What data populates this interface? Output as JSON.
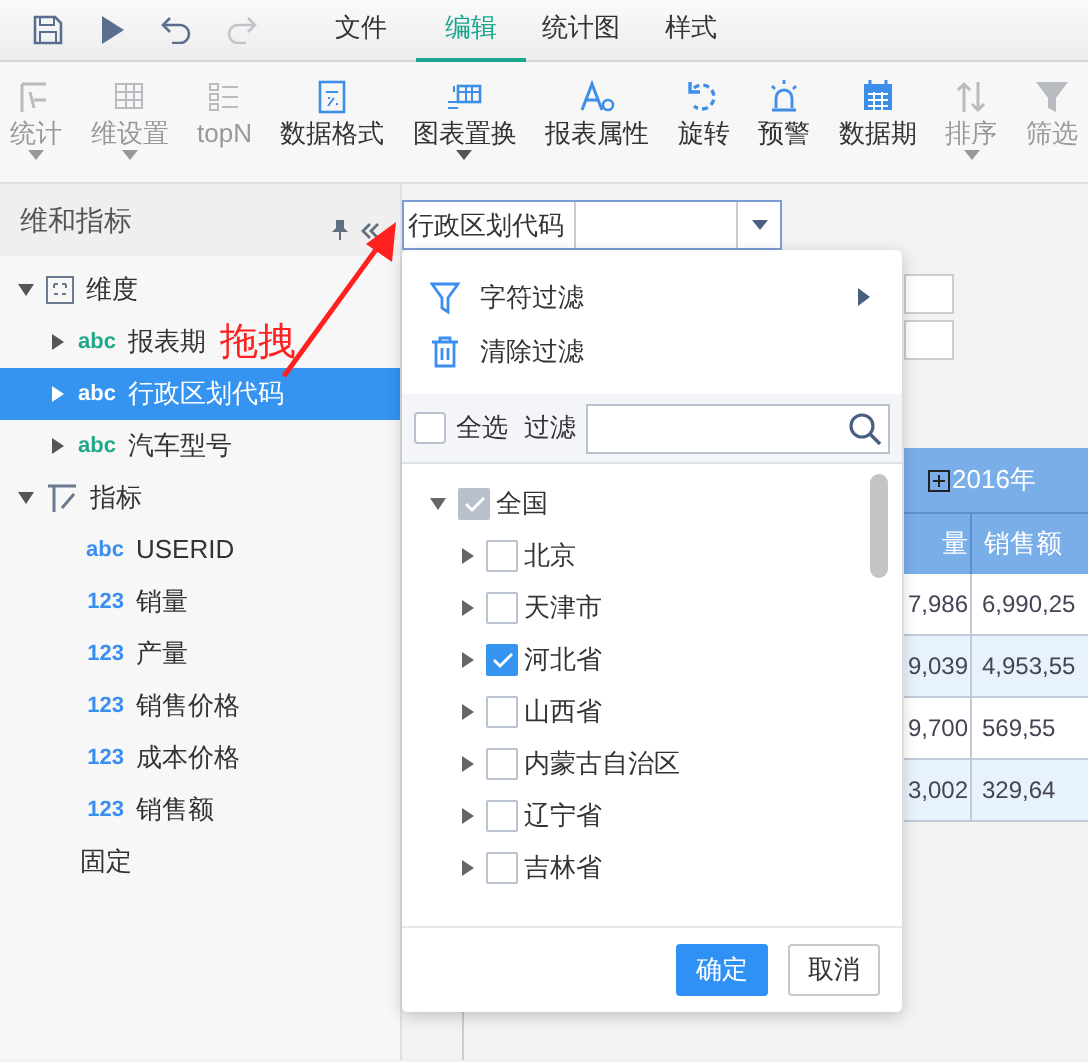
{
  "quick_actions": [
    {
      "kind": "save",
      "disabled": false
    },
    {
      "kind": "run",
      "disabled": false
    },
    {
      "kind": "undo",
      "disabled": false
    },
    {
      "kind": "redo",
      "disabled": true
    }
  ],
  "menu_tabs": [
    {
      "label": "文件",
      "selected": false
    },
    {
      "label": "编辑",
      "selected": true
    },
    {
      "label": "统计图",
      "selected": false
    },
    {
      "label": "样式",
      "selected": false
    }
  ],
  "ribbon": [
    {
      "kind": "stats",
      "label": "统计",
      "disabled": true,
      "has_menu": true
    },
    {
      "kind": "dim",
      "label": "维设置",
      "disabled": true,
      "has_menu": true
    },
    {
      "kind": "topn",
      "label": "topN",
      "disabled": true,
      "has_menu": false
    },
    {
      "kind": "format",
      "label": "数据格式",
      "disabled": false,
      "has_menu": false
    },
    {
      "kind": "swap",
      "label": "图表置换",
      "disabled": false,
      "has_menu": true
    },
    {
      "kind": "props",
      "label": "报表属性",
      "disabled": false,
      "has_menu": false
    },
    {
      "kind": "rotate",
      "label": "旋转",
      "disabled": false,
      "has_menu": false
    },
    {
      "kind": "alert",
      "label": "预警",
      "disabled": false,
      "has_menu": false
    },
    {
      "kind": "calendar",
      "label": "数据期",
      "disabled": false,
      "has_menu": false
    },
    {
      "kind": "sort",
      "label": "排序",
      "disabled": true,
      "has_menu": true
    },
    {
      "kind": "filter",
      "label": "筛选",
      "disabled": true,
      "has_menu": false
    }
  ],
  "panel": {
    "title": "维和指标",
    "tree": [
      {
        "label": "维度",
        "kind": "dimension",
        "expanded": true,
        "children": [
          {
            "label": "报表期",
            "badge": "abc",
            "kind": "text",
            "selected": false
          },
          {
            "label": "行政区划代码",
            "badge": "abc",
            "kind": "text",
            "selected": true
          },
          {
            "label": "汽车型号",
            "badge": "abc",
            "kind": "text",
            "selected": false
          }
        ]
      },
      {
        "label": "指标",
        "kind": "measure",
        "expanded": true,
        "children": [
          {
            "label": "USERID",
            "badge": "abc",
            "kind": "field",
            "selected": false
          },
          {
            "label": "销量",
            "badge": "123",
            "kind": "field",
            "selected": false
          },
          {
            "label": "产量",
            "badge": "123",
            "kind": "field",
            "selected": false
          },
          {
            "label": "销售价格",
            "badge": "123",
            "kind": "field",
            "selected": false
          },
          {
            "label": "成本价格",
            "badge": "123",
            "kind": "field",
            "selected": false
          },
          {
            "label": "销售额",
            "badge": "123",
            "kind": "field",
            "selected": false
          },
          {
            "label": "固定",
            "kind": "plain",
            "selected": false
          }
        ]
      }
    ]
  },
  "annotation": {
    "text": "拖拽"
  },
  "field_selector": {
    "value": "行政区划代码"
  },
  "popup": {
    "menu": [
      {
        "kind": "filter",
        "label": "字符过滤",
        "has_submenu": true
      },
      {
        "kind": "clear",
        "label": "清除过滤",
        "has_submenu": false
      }
    ],
    "select_all": {
      "label": "全选",
      "checked": false
    },
    "filter_label": "过滤",
    "tree": [
      {
        "label": "全国",
        "expanded": true,
        "checked": true,
        "disabled": true,
        "children": [
          {
            "label": "北京",
            "checked": false
          },
          {
            "label": "天津市",
            "checked": false
          },
          {
            "label": "河北省",
            "checked": true
          },
          {
            "label": "山西省",
            "checked": false
          },
          {
            "label": "内蒙古自治区",
            "checked": false
          },
          {
            "label": "辽宁省",
            "checked": false
          },
          {
            "label": "吉林省",
            "checked": false
          }
        ]
      }
    ],
    "buttons": [
      {
        "label": "确定",
        "primary": true
      },
      {
        "label": "取消",
        "primary": false
      }
    ]
  },
  "table": {
    "header": "2016年",
    "columns": [
      "量",
      "销售额"
    ],
    "rows": [
      [
        "7,986",
        "6,990,25"
      ],
      [
        "9,039",
        "4,953,55"
      ],
      [
        "9,700",
        "569,55"
      ],
      [
        "3,002",
        "329,64"
      ]
    ]
  }
}
